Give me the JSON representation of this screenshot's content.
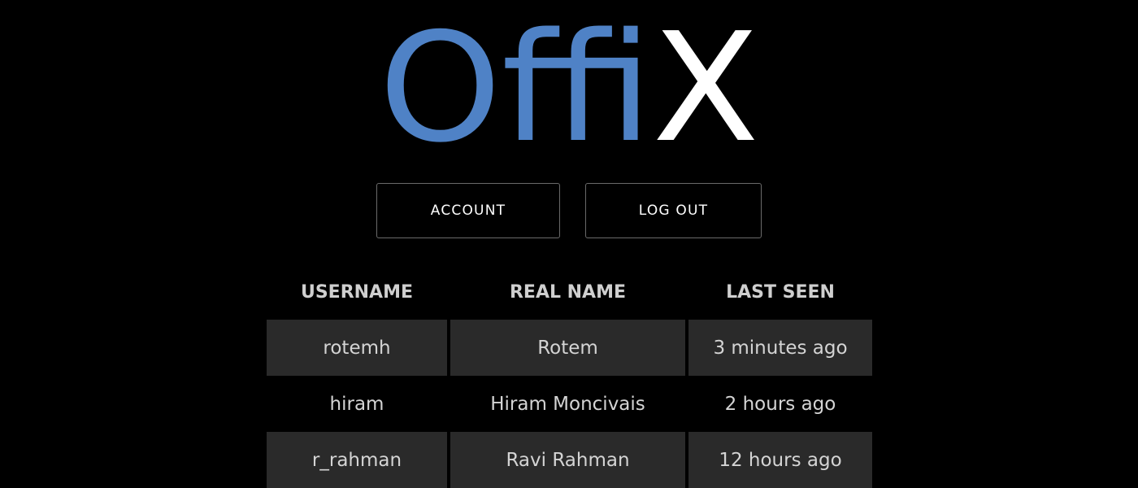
{
  "logo": {
    "text_blue": "Offi",
    "text_white": "X",
    "blue_color": "#4f82c6",
    "white_color": "#ffffff"
  },
  "nav": {
    "account_label": "ACCOUNT",
    "logout_label": "LOG OUT"
  },
  "table": {
    "headers": [
      "USERNAME",
      "REAL NAME",
      "LAST SEEN"
    ],
    "rows": [
      {
        "username": "rotemh",
        "real_name": "Rotem",
        "last_seen": "3 minutes ago"
      },
      {
        "username": "hiram",
        "real_name": "Hiram Moncivais",
        "last_seen": "2 hours ago"
      },
      {
        "username": "r_rahman",
        "real_name": "Ravi Rahman",
        "last_seen": "12 hours ago"
      }
    ]
  }
}
